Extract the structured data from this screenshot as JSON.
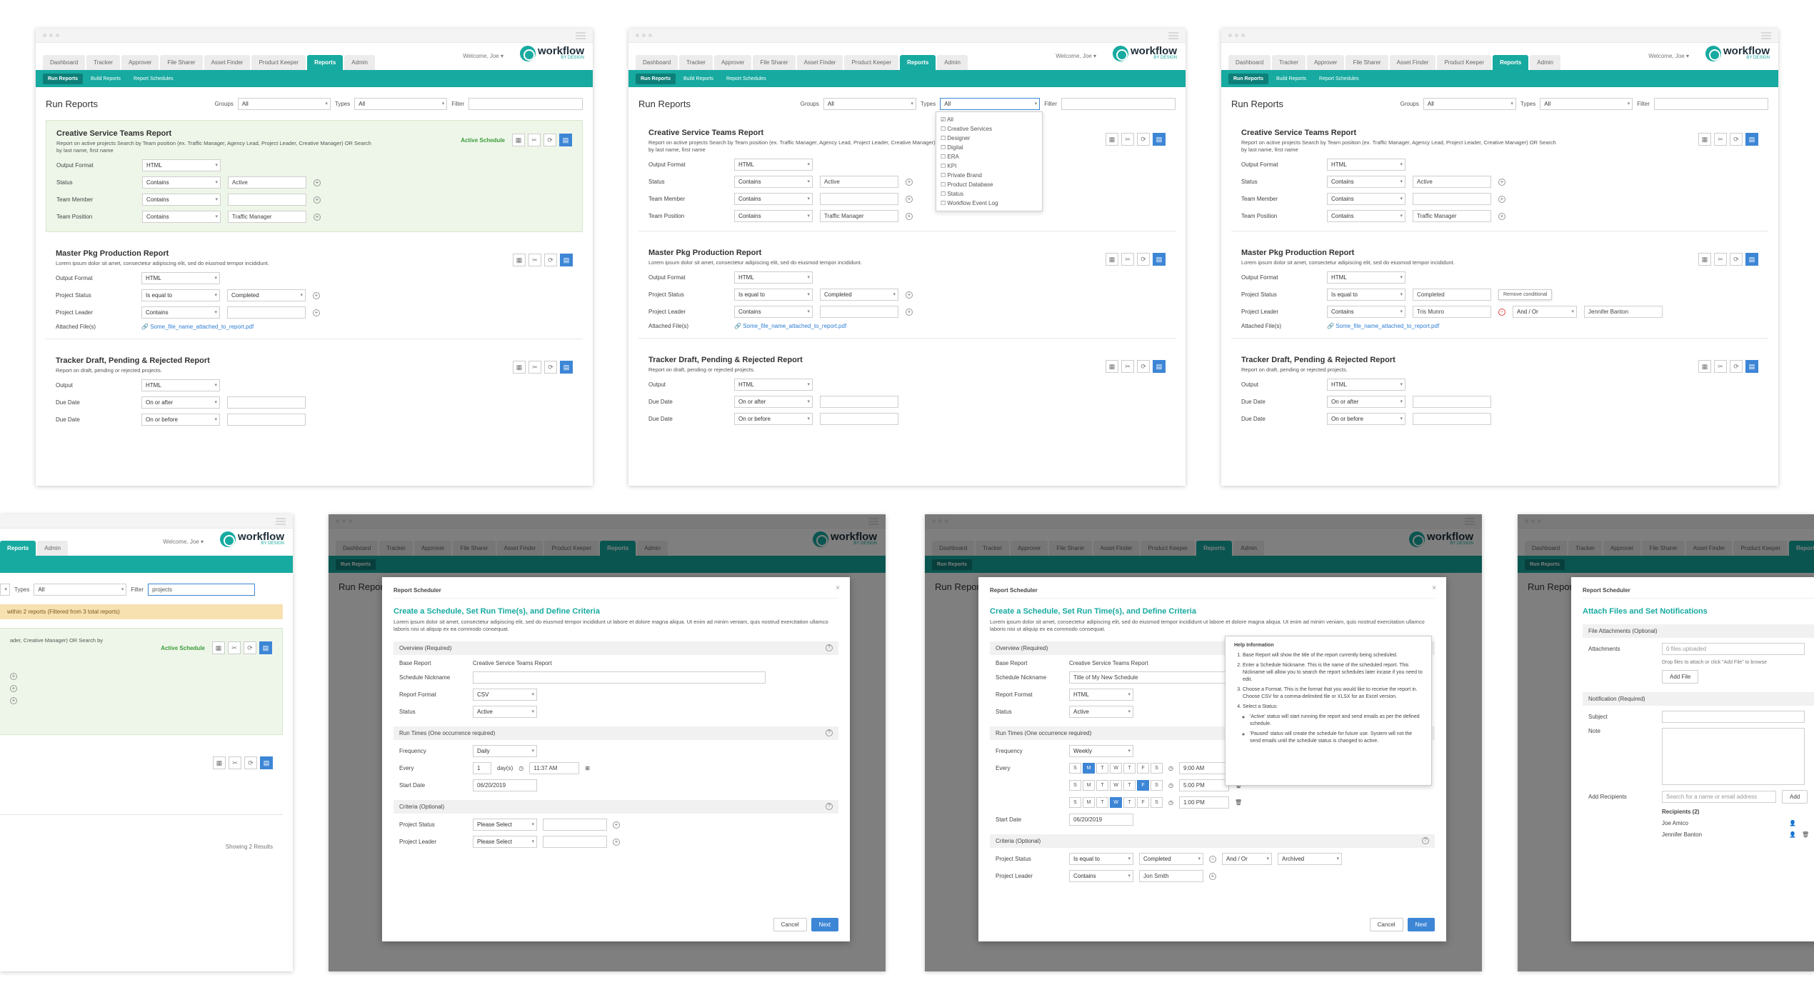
{
  "nav": {
    "tabs": [
      "Dashboard",
      "Tracker",
      "Approver",
      "File Sharer",
      "Asset Finder",
      "Product Keeper",
      "Reports",
      "Admin"
    ],
    "welcome": "Welcome, Joe",
    "logo_text": "workflow",
    "logo_sub": "BY DESIGN",
    "subtabs": [
      "Run Reports",
      "Build Reports",
      "Report Schedules"
    ]
  },
  "page": {
    "title": "Run Reports",
    "groups_label": "Groups",
    "groups_value": "All",
    "types_label": "Types",
    "types_value": "All",
    "filter_label": "Filter",
    "filter_value_search": "projects"
  },
  "types_options": [
    "All",
    "Creative Services",
    "Designer",
    "Digital",
    "ERA",
    "KPI",
    "Private Brand",
    "Product Database",
    "Status",
    "Workflow Event Log"
  ],
  "reports": {
    "creative": {
      "title": "Creative Service Teams Report",
      "desc": "Report on active projects Search by Team position (ex. Traffic Manager, Agency Lead, Project Leader, Creative Manager) OR Search by last name, first name",
      "active_schedule": "Active Schedule",
      "output_label": "Output Format",
      "output_value": "HTML",
      "status_label": "Status",
      "status_op": "Contains",
      "status_value": "Active",
      "member_label": "Team Member",
      "member_op": "Contains",
      "position_label": "Team Position",
      "position_op": "Contains",
      "position_value": "Traffic Manager"
    },
    "master": {
      "title": "Master Pkg Production Report",
      "desc": "Lorem ipsum dolor sit amet, consectetur adipiscing elit, sed do eiusmod tempor incididunt.",
      "output_label": "Output Format",
      "output_value": "HTML",
      "pstatus_label": "Project Status",
      "pstatus_op": "Is equal to",
      "pstatus_value": "Completed",
      "leader_label": "Project Leader",
      "leader_op": "Contains",
      "leader_value": "Tris Munro",
      "andor": "And / Or",
      "leader_value2": "Jennifer Banton",
      "files_label": "Attached File(s)",
      "file_name": "Some_file_name_attached_to_report.pdf",
      "remove_tooltip": "Remove conditional"
    },
    "tracker": {
      "title": "Tracker Draft, Pending & Rejected Report",
      "desc": "Report on draft, pending or rejected projects.",
      "output_label": "Output",
      "output_value": "HTML",
      "due_label": "Due Date",
      "due_op1": "On or after",
      "due_op2": "On or before"
    }
  },
  "search_banner": "within 2 reports (Filtered from 3 total reports)",
  "search_desc_frag": "ader, Creative Manager) OR Search by",
  "showing": "Showing 2 Results",
  "scheduler": {
    "header": "Report Scheduler",
    "title": "Create a Schedule, Set Run Time(s), and Define Criteria",
    "desc": "Lorem ipsum dolor sit amet, consectetur adipiscing elit, sed do eiusmod tempor incididunt ut labore et dolore magna aliqua. Ut enim ad minim veniam, quis nostrud exercitation ullamco laboris nisi ut aliquip ex ea commodo consequat.",
    "overview": "Overview (Required)",
    "base_label": "Base Report",
    "base_value": "Creative Service Teams Report",
    "nick_label": "Schedule Nickname",
    "nick_value": "Title of My New Schedule",
    "format_label": "Report Format",
    "format_csv": "CSV",
    "format_html": "HTML",
    "status_label": "Status",
    "status_value": "Active",
    "runtimes": "Run Times (One occurrence required)",
    "freq_label": "Frequency",
    "freq_daily": "Daily",
    "freq_weekly": "Weekly",
    "every_label": "Every",
    "every_value": "1",
    "every_unit": "day(s)",
    "time_value": "11:37 AM",
    "start_label": "Start Date",
    "start_value": "06/20/2019",
    "criteria": "Criteria (Optional)",
    "pstatus_label": "Project Status",
    "pleader_label": "Project Leader",
    "please_select": "Please Select",
    "is_equal": "Is equal to",
    "completed": "Completed",
    "andor": "And / Or",
    "archived": "Archived",
    "contains": "Contains",
    "jon": "Jon Smith",
    "days": [
      "S",
      "M",
      "T",
      "W",
      "T",
      "F",
      "S"
    ],
    "times": [
      "9:00 AM",
      "5:00 PM",
      "1:00 PM"
    ],
    "cancel": "Cancel",
    "next": "Next"
  },
  "help": {
    "title": "Help Information",
    "items": [
      "Base Report will show the title of the report currently being scheduled.",
      "Enter a Schedule Nickname. This is the name of the scheduled report. This Nickname will allow you to search the report schedules later incase if you need to edit.",
      "Choose a Format. This is the format that you would like to receive the report in. Choose CSV for a comma-delimited file or XLSX for an Excel version.",
      "Select a Status:",
      "'Active' status will start running the report and send emails as per the defined schedule.",
      "'Paused' status will create the schedule for future use. System will not the send emails until the schedule status is changed to active."
    ]
  },
  "notify": {
    "title": "Attach Files and Set Notifications",
    "file_section": "File Attachments (Optional)",
    "attach_label": "Attachments",
    "attach_value": "0 files uploaded",
    "drop_hint": "Drop files to attach or click \"Add File\" to browse",
    "add_file": "Add File",
    "notif_section": "Notification (Required)",
    "subject_label": "Subject",
    "note_label": "Note",
    "recipients_label": "Add Recipients",
    "recipients_placeholder": "Search for a name or email address",
    "add": "Add",
    "recipients_count": "Recipients (2)",
    "recipients": [
      "Joe Amico",
      "Jennifer Banton"
    ]
  }
}
